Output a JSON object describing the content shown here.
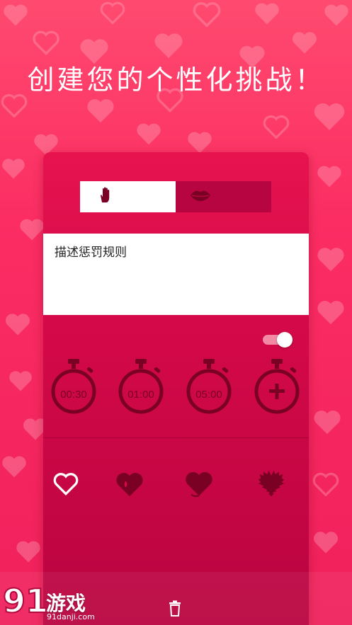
{
  "headline": "创建您的个性化挑战！",
  "mode_selector": {
    "options": [
      {
        "icon": "hand-icon",
        "selected": true
      },
      {
        "icon": "lips-icon",
        "selected": false
      }
    ]
  },
  "rules_input": {
    "value": "描述惩罚规则"
  },
  "toggle": {
    "on": true
  },
  "timers": [
    {
      "label": "00:30"
    },
    {
      "label": "01:00"
    },
    {
      "label": "05:00"
    },
    {
      "label": "+",
      "icon": "add-timer-icon"
    }
  ],
  "heart_styles": [
    {
      "icon": "heart-outline-icon",
      "selected": true
    },
    {
      "icon": "heart-drop-icon",
      "selected": false
    },
    {
      "icon": "heart-devil-icon",
      "selected": false
    },
    {
      "icon": "heart-fuzzy-icon",
      "selected": false
    }
  ],
  "actions": {
    "delete_icon": "trash-icon"
  },
  "watermark": {
    "text": "游戏",
    "logo": "91",
    "sub": "91danji.com"
  },
  "colors": {
    "accent": "#e6134f",
    "dark": "#7a0024",
    "background": "#fb2d63"
  }
}
